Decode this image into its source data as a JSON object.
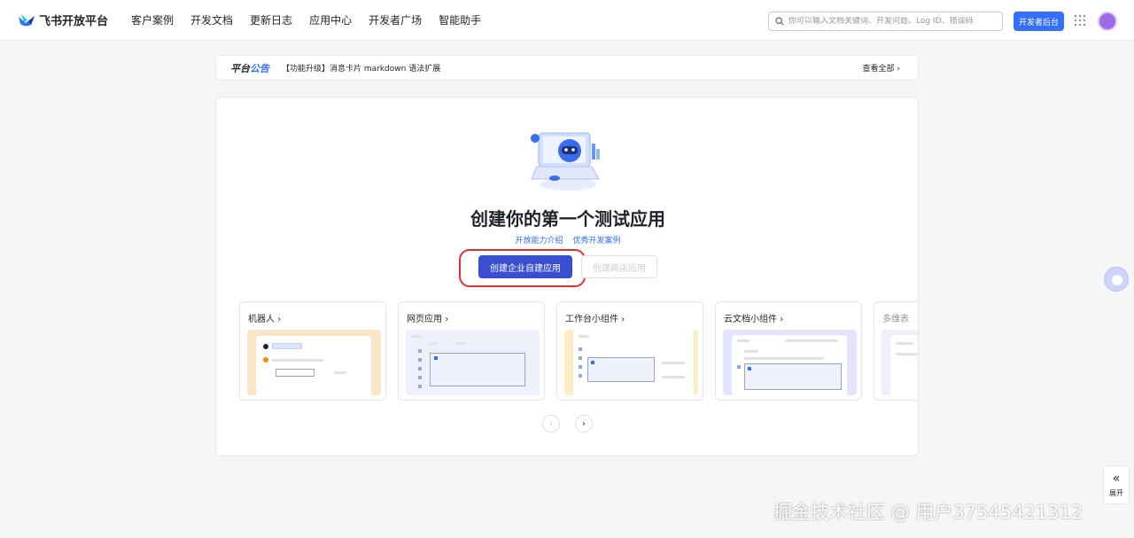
{
  "brand": {
    "name": "飞书开放平台"
  },
  "nav": {
    "items": [
      {
        "label": "客户案例"
      },
      {
        "label": "开发文档"
      },
      {
        "label": "更新日志"
      },
      {
        "label": "应用中心"
      },
      {
        "label": "开发者广场"
      },
      {
        "label": "智能助手"
      }
    ]
  },
  "search": {
    "placeholder": "你可以输入文档关键词、开发问题、Log ID、错误码",
    "icon": "search-icon"
  },
  "header": {
    "dev_console_label": "开发者后台"
  },
  "announcement": {
    "title_part1": "平台",
    "title_part2": "公告",
    "text": "【功能升级】消息卡片 markdown 语法扩展",
    "more_label": "查看全部"
  },
  "main": {
    "headline": "创建你的第一个测试应用",
    "links": [
      {
        "label": "开放能力介绍"
      },
      {
        "label": "优秀开发案例"
      }
    ],
    "create_enterprise_label": "创建企业自建应用",
    "create_store_label": "创建商店应用"
  },
  "cards": [
    {
      "title": "机器人",
      "chevron": "›",
      "preview_color": "#fde6c8"
    },
    {
      "title": "网页应用",
      "chevron": "›",
      "preview_color": "#dfe4fb"
    },
    {
      "title": "工作台小组件",
      "chevron": "›",
      "preview_color": "#fbedc4"
    },
    {
      "title": "云文档小组件",
      "chevron": "›",
      "preview_color": "#e1e4fb"
    },
    {
      "title": "多维表",
      "chevron": "",
      "preview_color": "#eef0f7"
    }
  ],
  "pager": {
    "prev": "‹",
    "next": "›"
  },
  "side": {
    "expand_label": "展开",
    "expand_icon": "«"
  },
  "colors": {
    "primary": "#3370ff",
    "create_button": "#3a4ed1",
    "highlight": "#e0312e"
  },
  "watermark": "掘金技术社区 @ 用户37545421312"
}
